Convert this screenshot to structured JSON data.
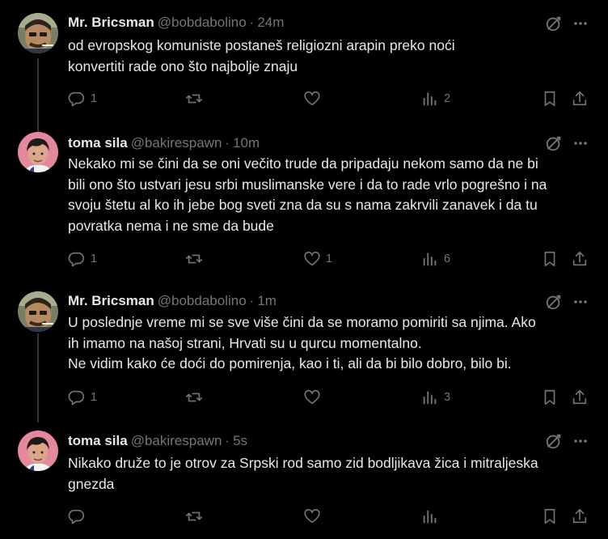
{
  "tweets": [
    {
      "name": "Mr. Bricsman",
      "handle": "@bobdabolino",
      "time": "24m",
      "lines": [
        "od evropskog komuniste postaneš religiozni arapin preko noći",
        "konvertiti rade ono što najbolje znaju"
      ],
      "replies": "1",
      "reposts": "",
      "likes": "",
      "views": "2",
      "avatar": "bricsman"
    },
    {
      "name": "toma sila",
      "handle": "@bakirespawn",
      "time": "10m",
      "lines": [
        "Nekako mi se čini da se oni večito trude da pripadaju nekom samo da ne bi",
        "bili ono što ustvari jesu srbi muslimanske vere i da to rade vrlo pogrešno i na",
        "svoju štetu al ko ih jebe bog sveti zna da su s nama zakrvili zanavek i da tu",
        "povratka nema i ne sme da bude"
      ],
      "replies": "1",
      "reposts": "",
      "likes": "1",
      "views": "6",
      "avatar": "toma"
    },
    {
      "name": "Mr. Bricsman",
      "handle": "@bobdabolino",
      "time": "1m",
      "lines": [
        "U poslednje vreme mi se sve više čini da se moramo pomiriti sa njima. Ako",
        "ih imamo na našoj strani, Hrvati su u qurcu momentalno.",
        "Ne vidim kako će doći do pomirenja, kao i ti, ali da bi bilo dobro, bilo bi."
      ],
      "replies": "1",
      "reposts": "",
      "likes": "",
      "views": "3",
      "avatar": "bricsman"
    },
    {
      "name": "toma sila",
      "handle": "@bakirespawn",
      "time": "5s",
      "lines": [
        "Nikako druže to je otrov za Srpski rod samo zid bodljikava žica i mitraljeska",
        "gnezda"
      ],
      "replies": "",
      "reposts": "",
      "likes": "",
      "views": "",
      "avatar": "toma"
    }
  ],
  "separator": "·",
  "icons": [
    "reply-icon",
    "repost-icon",
    "like-icon",
    "views-icon",
    "bookmark-icon",
    "share-icon",
    "grok-icon",
    "more-icon"
  ],
  "colors": {
    "background": "#000000",
    "text": "#e7e9ea",
    "muted": "#71767b",
    "thread_line": "#333639"
  }
}
